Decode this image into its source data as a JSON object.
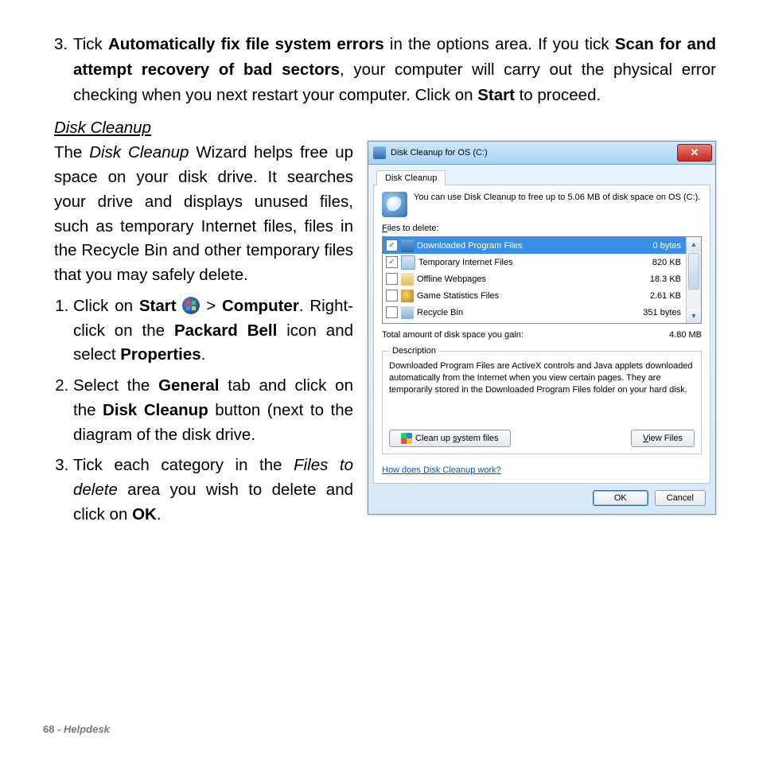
{
  "doc": {
    "step3_top": {
      "num": "3.",
      "p1a": "Tick ",
      "b1": "Automatically fix file system errors",
      "p1b": " in the options area. If you tick ",
      "b2": "Scan for and attempt recovery of bad sectors",
      "p1c": ", your computer will carry out the physical error checking when you next restart your computer. Click on ",
      "b3": "Start",
      "p1d": " to proceed."
    },
    "heading": "Disk Cleanup",
    "intro": {
      "a": "The ",
      "i": "Disk Cleanup",
      "b": " Wizard helps free up space on your disk drive. It searches your drive and displays unused files, such as temporary Internet files, files in the Recycle Bin and other temporary files that you may safely delete."
    },
    "steps": {
      "s1": {
        "a": "Click on ",
        "b1": "Start",
        "mid": "  >  ",
        "b2": "Computer",
        "c": ". Right-click on the ",
        "b3": "Packard Bell",
        "d": " icon and select ",
        "b4": "Properties",
        "e": "."
      },
      "s2": {
        "a": "Select the ",
        "b1": "General",
        "b": " tab and click on the ",
        "b2": "Disk Cleanup",
        "c": " button (next to the diagram of the disk drive."
      },
      "s3": {
        "a": "Tick each category in the ",
        "i": "Files to delete",
        "b": " area you wish to delete and click on ",
        "b1": "OK",
        "c": "."
      }
    },
    "footer": {
      "page": "68 - ",
      "section": "Helpdesk"
    }
  },
  "win": {
    "title": "Disk Cleanup for OS (C:)",
    "tab": "Disk Cleanup",
    "info": "You can use Disk Cleanup to free up to 5.06 MB of disk space on OS (C:).",
    "files_label": "Files to delete:",
    "files": [
      {
        "checked": true,
        "name": "Downloaded Program Files",
        "size": "0 bytes",
        "iconClass": "fi-dl",
        "sel": true
      },
      {
        "checked": true,
        "name": "Temporary Internet Files",
        "size": "820 KB",
        "iconClass": "fi-tmp",
        "sel": false
      },
      {
        "checked": false,
        "name": "Offline Webpages",
        "size": "18.3 KB",
        "iconClass": "fi-off",
        "sel": false
      },
      {
        "checked": false,
        "name": "Game Statistics Files",
        "size": "2.61 KB",
        "iconClass": "fi-game",
        "sel": false
      },
      {
        "checked": false,
        "name": "Recycle Bin",
        "size": "351 bytes",
        "iconClass": "fi-bin",
        "sel": false
      }
    ],
    "total_label": "Total amount of disk space you gain:",
    "total_value": "4.80 MB",
    "desc_legend": "Description",
    "desc_text": "Downloaded Program Files are ActiveX controls and Java applets downloaded automatically from the Internet when you view certain pages. They are temporarily stored in the Downloaded Program Files folder on your hard disk.",
    "cleanup_btn": "Clean up system files",
    "view_btn": "View Files",
    "help_link": "How does Disk Cleanup work?",
    "ok": "OK",
    "cancel": "Cancel",
    "close": "✕",
    "scroll_up": "▲",
    "scroll_down": "▼"
  }
}
